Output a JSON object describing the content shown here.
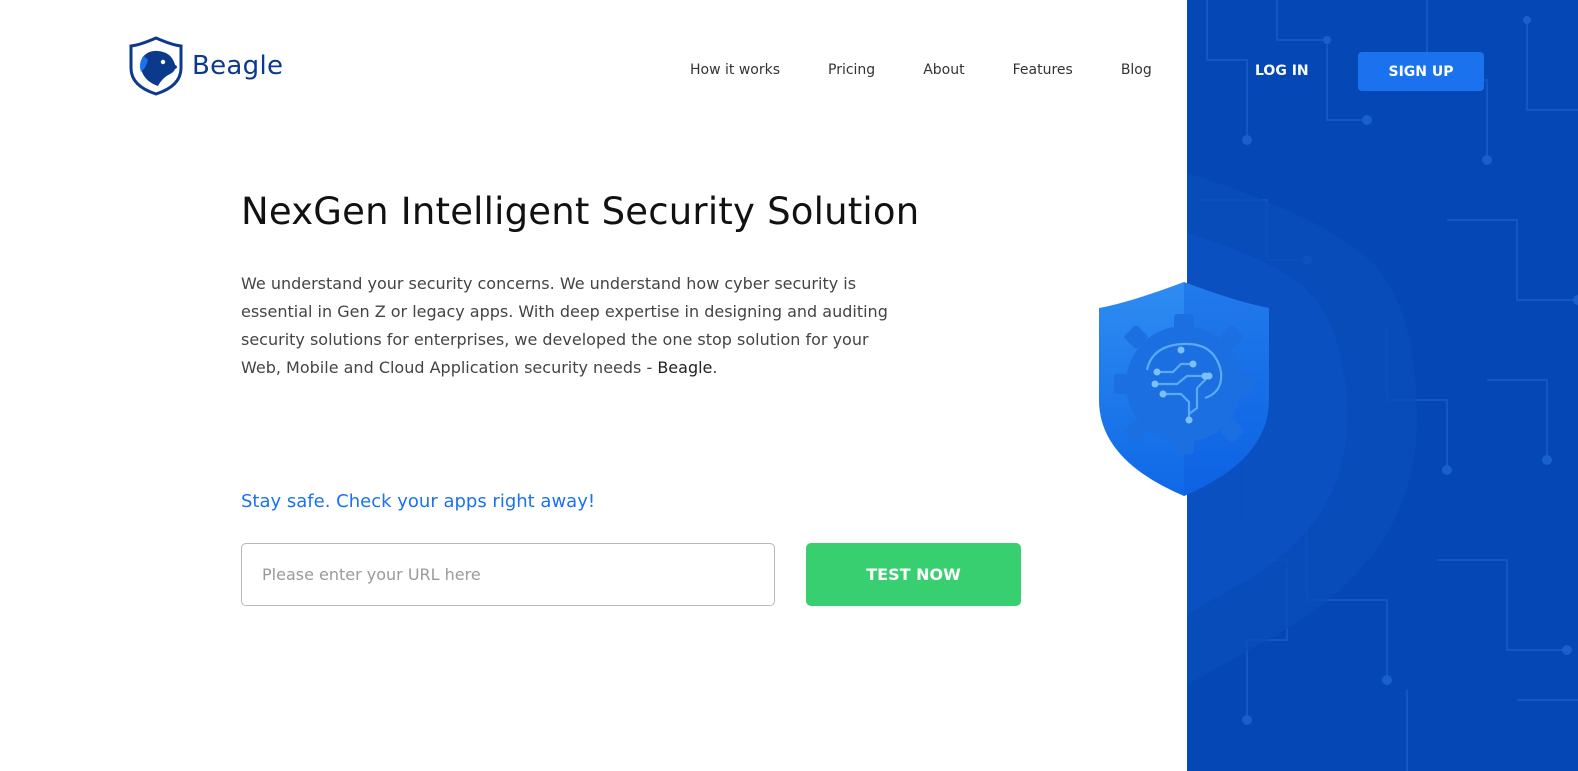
{
  "brand": {
    "name": "Beagle",
    "logo_icon": "beagle-shield-logo",
    "primary_color": "#0b3a8c",
    "accent_color": "#1a72ef"
  },
  "nav": {
    "items": [
      {
        "label": "How it works"
      },
      {
        "label": "Pricing"
      },
      {
        "label": "About"
      },
      {
        "label": "Features"
      },
      {
        "label": "Blog"
      }
    ],
    "login_label": "LOG IN",
    "signup_label": "SIGN UP"
  },
  "hero": {
    "title": "NexGen Intelligent Security Solution",
    "description": "We understand your security concerns. We understand how cyber security is essential in Gen Z or legacy apps. With deep expertise in designing and auditing security solutions for enterprises, we developed the one stop solution for your Web, Mobile and Cloud Application security needs - ",
    "description_brand": "Beagle",
    "description_end": "."
  },
  "cta": {
    "tagline": "Stay safe. Check your apps right away!",
    "url_placeholder": "Please enter your URL here",
    "url_value": "",
    "button_label": "TEST NOW",
    "button_color": "#37cf70"
  },
  "graphic": {
    "panel_color": "#0447b5",
    "shield_icon": "shield-gear-brain-icon"
  }
}
